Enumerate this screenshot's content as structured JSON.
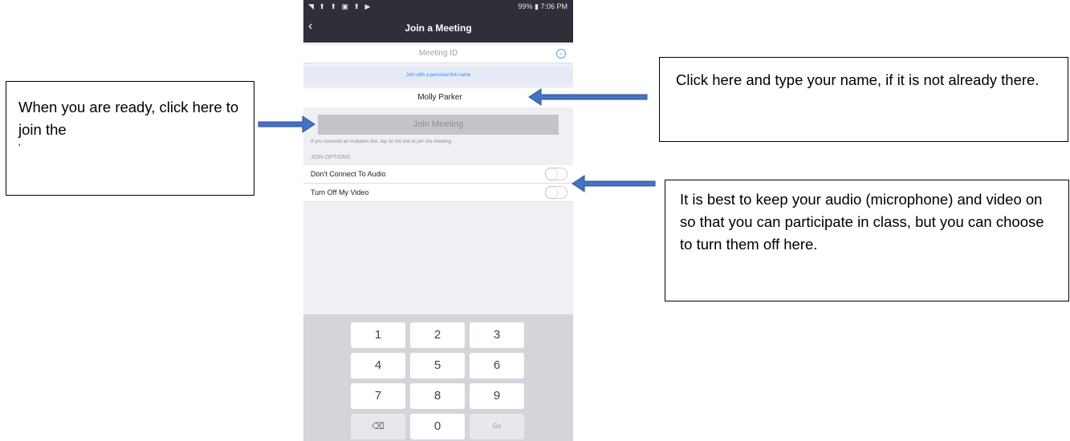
{
  "status_bar": {
    "left_icons": "◥ ⬆ ⬆ ▣ ⬆ ▶",
    "right": "99% ▮ 7:06 PM"
  },
  "nav": {
    "back_icon": "‹",
    "title": "Join a Meeting"
  },
  "form": {
    "meeting_id_placeholder": "Meeting ID",
    "dropdown_icon": "⌄",
    "personal_link": "Join with a personal link name",
    "name_value": "Molly Parker",
    "join_button": "Join Meeting",
    "invite_hint": "If you received an invitation link, tap on the link to join the meeting.",
    "options_label": "JOIN OPTIONS",
    "options": [
      {
        "label": "Don't Connect To Audio",
        "on": false
      },
      {
        "label": "Turn Off My Video",
        "on": false
      }
    ]
  },
  "keypad": {
    "keys": [
      "1",
      "2",
      "3",
      "4",
      "5",
      "6",
      "7",
      "8",
      "9",
      "⌫",
      "0",
      "Go"
    ]
  },
  "callouts": {
    "left": "When you are ready, click here to join the",
    "left_overflow": "'",
    "right_top": "Click here and type your name, if it is not already there.",
    "right_bottom": "It is best to keep your audio (microphone) and video on so that you can participate in class, but you can choose to turn them off here."
  },
  "colors": {
    "nav_bg": "#2f2f3a",
    "accent": "#2d8cff",
    "arrow": "#4472c4"
  }
}
